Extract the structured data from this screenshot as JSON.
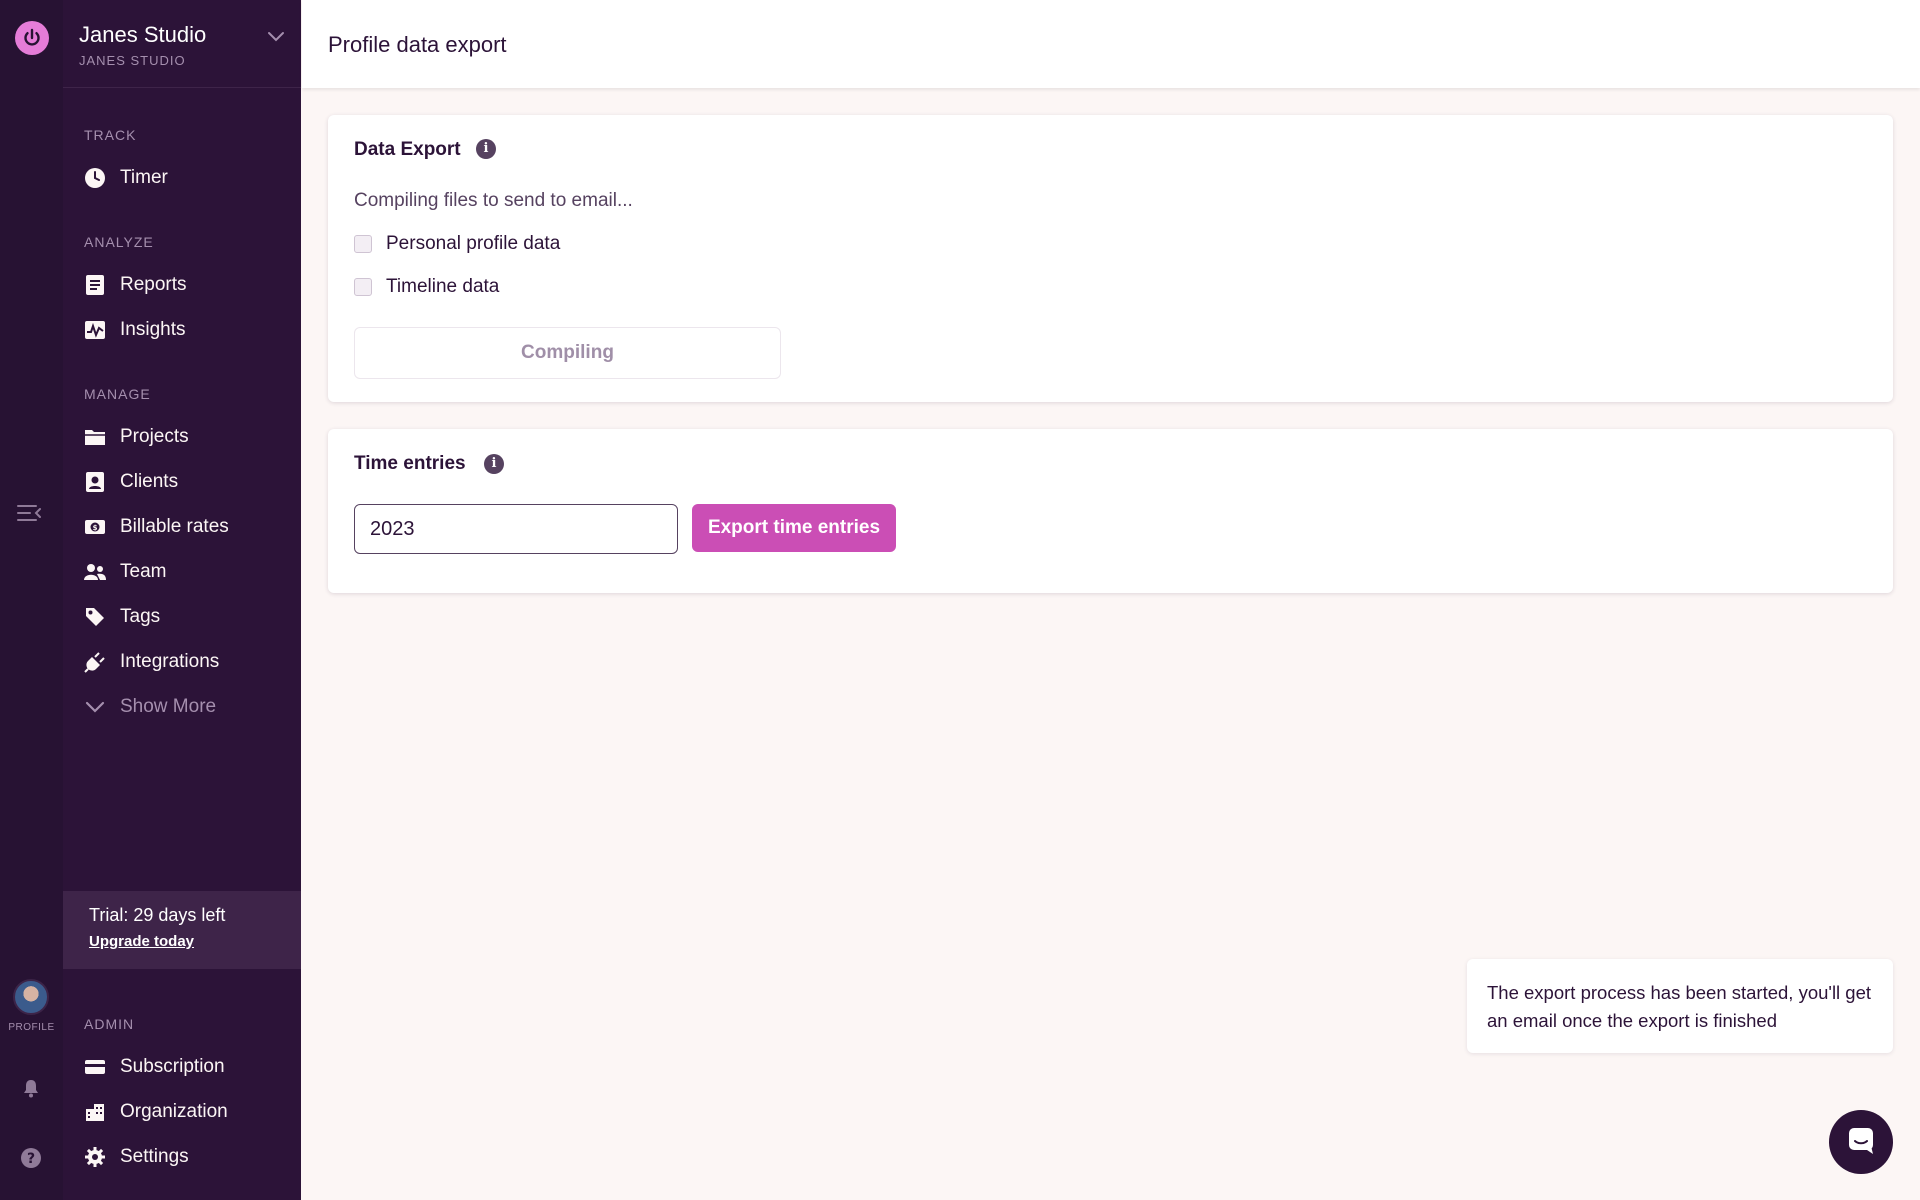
{
  "app": {
    "brand_color": "#e57cd8",
    "accent": "#cb4eb5",
    "sidebar_bg": "#2c1338"
  },
  "rail": {
    "profile_label": "PROFILE"
  },
  "workspace": {
    "name": "Janes Studio",
    "subtitle": "JANES STUDIO"
  },
  "sections": {
    "track": "TRACK",
    "analyze": "ANALYZE",
    "manage": "MANAGE",
    "admin": "ADMIN"
  },
  "nav": {
    "timer": {
      "label": "Timer",
      "icon": "clock-icon"
    },
    "reports": {
      "label": "Reports",
      "icon": "report-icon"
    },
    "insights": {
      "label": "Insights",
      "icon": "insights-icon"
    },
    "projects": {
      "label": "Projects",
      "icon": "folder-icon"
    },
    "clients": {
      "label": "Clients",
      "icon": "client-icon"
    },
    "billable_rates": {
      "label": "Billable rates",
      "icon": "money-icon"
    },
    "team": {
      "label": "Team",
      "icon": "team-icon"
    },
    "tags": {
      "label": "Tags",
      "icon": "tag-icon"
    },
    "integrations": {
      "label": "Integrations",
      "icon": "plug-icon"
    },
    "show_more": {
      "label": "Show More",
      "icon": "chevron-down-icon"
    },
    "subscription": {
      "label": "Subscription",
      "icon": "card-icon"
    },
    "organization": {
      "label": "Organization",
      "icon": "building-icon"
    },
    "settings": {
      "label": "Settings",
      "icon": "gear-icon"
    }
  },
  "trial": {
    "text": "Trial: 29 days left",
    "link": "Upgrade today"
  },
  "page": {
    "title": "Profile data export"
  },
  "data_export": {
    "title": "Data Export",
    "status": "Compiling files to send to email...",
    "options": [
      "Personal profile data",
      "Timeline data"
    ],
    "button": "Compiling"
  },
  "time_entries": {
    "title": "Time entries",
    "year_value": "2023",
    "button": "Export time entries"
  },
  "toast": {
    "message": "The export process has been started, you'll get an email once the export is finished"
  }
}
